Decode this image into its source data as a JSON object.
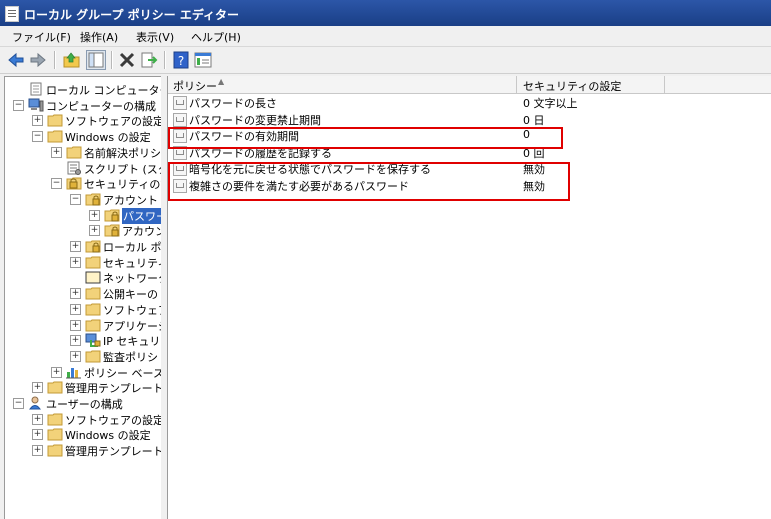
{
  "window": {
    "title": "ローカル グループ ポリシー エディター"
  },
  "menu": [
    "ファイル(F)",
    "操作(A)",
    "表示(V)",
    "ヘルプ(H)"
  ],
  "toolbar": [
    "back-icon",
    "forward-icon",
    "up-icon",
    "show-hide-tree-icon",
    "delete-icon",
    "export-icon",
    "help-icon",
    "properties-icon"
  ],
  "tree": [
    {
      "label": "ローカル コンピューター ポリシ",
      "level": 0,
      "expander": "",
      "icon": "policy"
    },
    {
      "label": "コンピューターの構成",
      "level": 0,
      "expander": "−",
      "icon": "computer"
    },
    {
      "label": "ソフトウェアの設定",
      "level": 1,
      "expander": "+",
      "icon": "folder"
    },
    {
      "label": "Windows の設定",
      "level": 1,
      "expander": "−",
      "icon": "folder"
    },
    {
      "label": "名前解決ポリシ",
      "level": 2,
      "expander": "+",
      "icon": "folder"
    },
    {
      "label": "スクリプト (スタ",
      "level": 2,
      "expander": "",
      "icon": "script"
    },
    {
      "label": "セキュリティの設",
      "level": 2,
      "expander": "−",
      "icon": "security"
    },
    {
      "label": "アカウント ポ",
      "level": 3,
      "expander": "−",
      "icon": "folder-lock"
    },
    {
      "label": "パスワード",
      "level": 4,
      "expander": "+",
      "icon": "folder-lock",
      "selected": true
    },
    {
      "label": "アカウン",
      "level": 4,
      "expander": "+",
      "icon": "folder-lock"
    },
    {
      "label": "ローカル ポ",
      "level": 3,
      "expander": "+",
      "icon": "folder-lock"
    },
    {
      "label": "セキュリティ",
      "level": 3,
      "expander": "+",
      "icon": "folder"
    },
    {
      "label": "ネットワーク",
      "level": 3,
      "expander": "",
      "icon": "folder-open"
    },
    {
      "label": "公開キーの",
      "level": 3,
      "expander": "+",
      "icon": "folder"
    },
    {
      "label": "ソフトウェア",
      "level": 3,
      "expander": "+",
      "icon": "folder"
    },
    {
      "label": "アプリケーシ",
      "level": 3,
      "expander": "+",
      "icon": "folder"
    },
    {
      "label": "IP セキュリ",
      "level": 3,
      "expander": "+",
      "icon": "ipsec"
    },
    {
      "label": "監査ポリシ",
      "level": 3,
      "expander": "+",
      "icon": "folder"
    },
    {
      "label": "ポリシー ベース",
      "level": 2,
      "expander": "+",
      "icon": "chart"
    },
    {
      "label": "管理用テンプレート",
      "level": 1,
      "expander": "+",
      "icon": "folder"
    },
    {
      "label": "ユーザーの構成",
      "level": 0,
      "expander": "−",
      "icon": "user"
    },
    {
      "label": "ソフトウェアの設定",
      "level": 1,
      "expander": "+",
      "icon": "folder"
    },
    {
      "label": "Windows の設定",
      "level": 1,
      "expander": "+",
      "icon": "folder"
    },
    {
      "label": "管理用テンプレート",
      "level": 1,
      "expander": "+",
      "icon": "folder"
    }
  ],
  "list": {
    "col_policy": "ポリシー",
    "col_setting": "セキュリティの設定",
    "rows": [
      {
        "name": "パスワードの長さ",
        "value": "0 文字以上"
      },
      {
        "name": "パスワードの変更禁止期間",
        "value": "0 日"
      },
      {
        "name": "パスワードの有効期間",
        "value": "0"
      },
      {
        "name": "パスワードの履歴を記録する",
        "value": "0 回"
      },
      {
        "name": "暗号化を元に戻せる状態でパスワードを保存する",
        "value": "無効"
      },
      {
        "name": "複雑さの要件を満たす必要があるパスワード",
        "value": "無効"
      }
    ]
  },
  "colors": {
    "highlight": "#e00000",
    "selection": "#3066c2"
  }
}
